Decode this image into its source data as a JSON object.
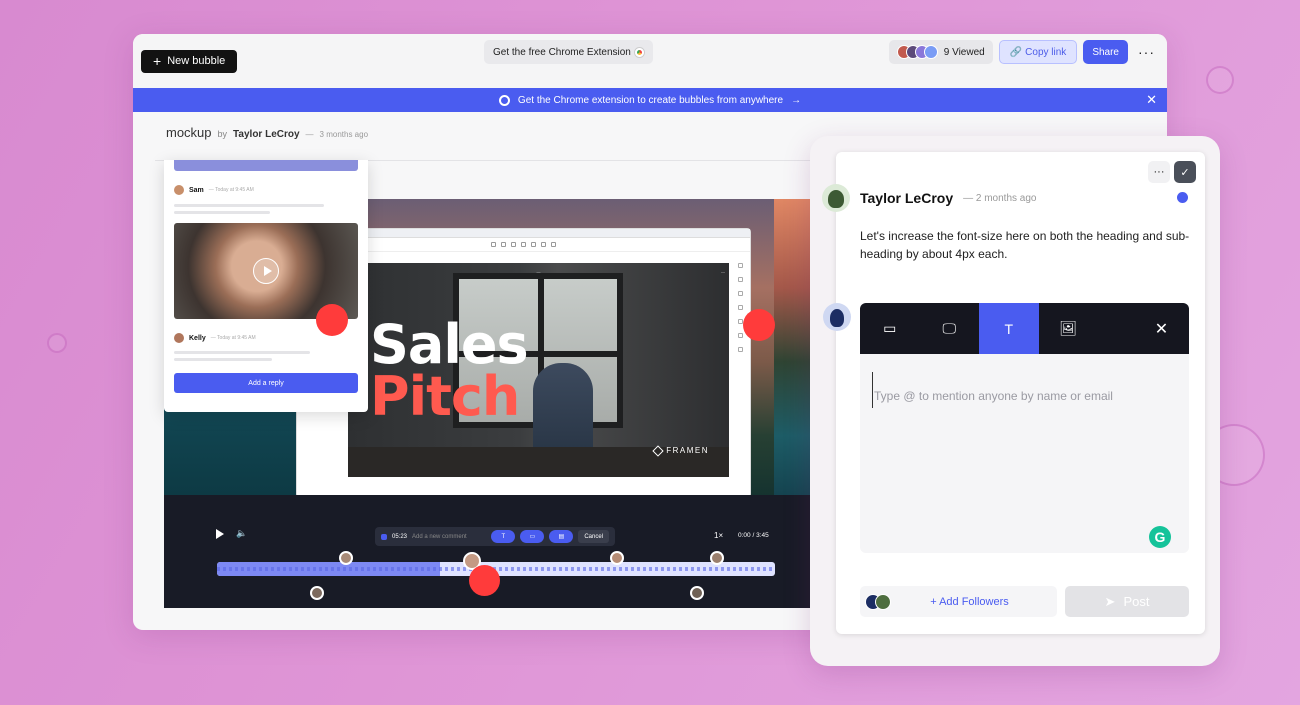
{
  "topbar": {
    "new_bubble": "New bubble",
    "chrome_extension": "Get the free Chrome Extension",
    "viewed": "9 Viewed",
    "copy_link": "Copy link",
    "share": "Share",
    "more": "···"
  },
  "banner": {
    "text": "Get the Chrome extension to create bubbles from anywhere",
    "arrow": "→",
    "close": "✕"
  },
  "breadcrumb": {
    "title": "mockup",
    "by": "by",
    "author": "Taylor LeCroy",
    "sep": "—",
    "ago": "3 months ago"
  },
  "slide": {
    "line1": "Sales",
    "line2": "Pitch",
    "brand": "FRAMEN"
  },
  "thread": {
    "comments": [
      {
        "author": "Sam",
        "time": "— Today at 9:45 AM"
      },
      {
        "author": "Kelly",
        "time": "— Today at 9:45 AM"
      }
    ],
    "reply_button": "Add a reply"
  },
  "player": {
    "current_comment_time": "05:23",
    "comment_placeholder": "Add a new comment",
    "cancel": "Cancel",
    "speed": "1×",
    "time": "0:00 / 3:45",
    "progress_fraction": 0.4
  },
  "comment": {
    "author": "Taylor LeCroy",
    "ago": "— 2 months ago",
    "body": "Let's increase the font-size here on both the heading and sub-heading by about 4px each."
  },
  "composer": {
    "placeholder": "Type @ to mention anyone by name or email",
    "add_followers": "+ Add Followers",
    "post": "Post"
  },
  "colors": {
    "accent": "#4a5cf0",
    "marker_red": "#ff3b3b",
    "background": "#d88ad0",
    "dark": "#15161f"
  }
}
